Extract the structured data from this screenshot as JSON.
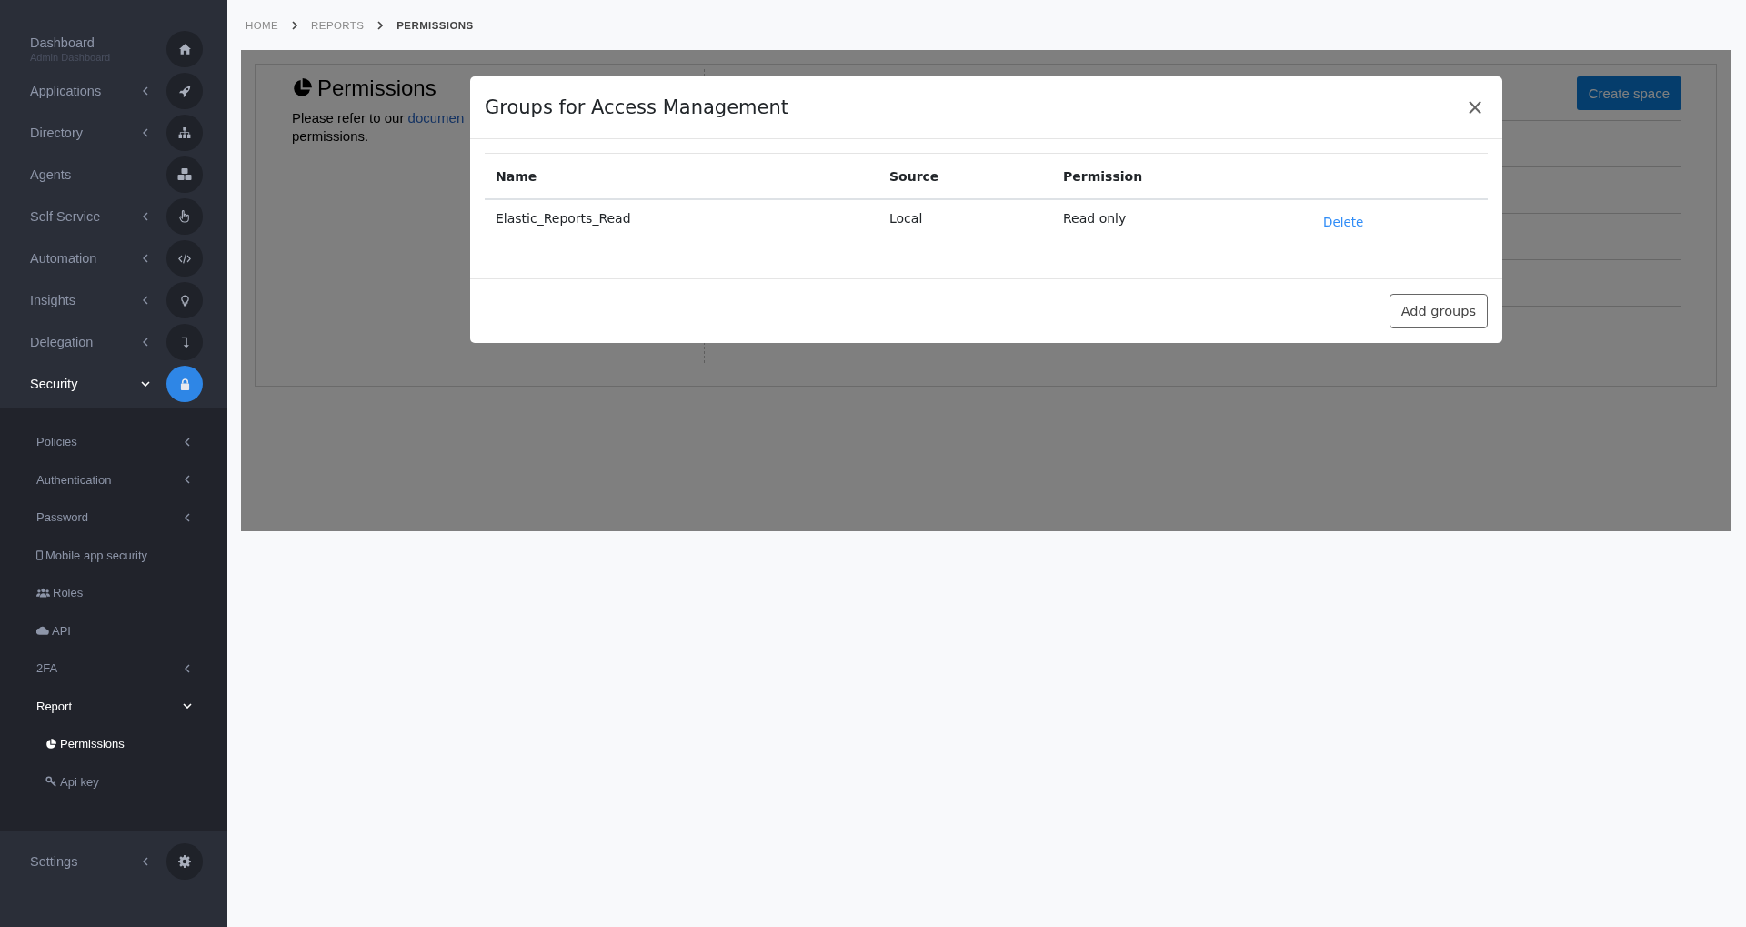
{
  "sidebar": {
    "items": [
      {
        "label": "Dashboard",
        "subtitle": "Admin Dashboard",
        "expandable": false,
        "expanded": false,
        "selected": false
      },
      {
        "label": "Applications",
        "expandable": true,
        "expanded": false,
        "selected": false
      },
      {
        "label": "Directory",
        "expandable": true,
        "expanded": false,
        "selected": false
      },
      {
        "label": "Agents",
        "expandable": false,
        "expanded": false,
        "selected": false
      },
      {
        "label": "Self Service",
        "expandable": true,
        "expanded": false,
        "selected": false
      },
      {
        "label": "Automation",
        "expandable": true,
        "expanded": false,
        "selected": false
      },
      {
        "label": "Insights",
        "expandable": true,
        "expanded": false,
        "selected": false
      },
      {
        "label": "Delegation",
        "expandable": true,
        "expanded": false,
        "selected": false
      },
      {
        "label": "Security",
        "expandable": true,
        "expanded": true,
        "selected": true,
        "children": [
          {
            "label": "Policies",
            "expandable": true,
            "expanded": false
          },
          {
            "label": "Authentication",
            "expandable": true,
            "expanded": false
          },
          {
            "label": "Password",
            "expandable": true,
            "expanded": false
          },
          {
            "label": "Mobile app security",
            "expandable": false,
            "expanded": false
          },
          {
            "label": "Roles",
            "expandable": false,
            "expanded": false
          },
          {
            "label": "API",
            "expandable": false,
            "expanded": false
          },
          {
            "label": "2FA",
            "expandable": true,
            "expanded": false
          },
          {
            "label": "Report",
            "expandable": true,
            "expanded": true,
            "children": [
              {
                "label": "Permissions",
                "selected": true
              },
              {
                "label": "Api key",
                "selected": false
              }
            ]
          }
        ]
      }
    ],
    "footer_items": [
      {
        "label": "Settings",
        "expandable": true,
        "expanded": false,
        "selected": false
      }
    ]
  },
  "breadcrumb": [
    {
      "label": "HOME",
      "selected": false
    },
    {
      "label": "REPORTS",
      "selected": false
    },
    {
      "label": "PERMISSIONS",
      "selected": true
    }
  ],
  "page": {
    "title": "Permissions",
    "text_before_link": "Please refer to our",
    "link": "documen",
    "text_line_2": "permissions.",
    "create_button": "Create space"
  },
  "modal": {
    "title": "Groups for Access Management",
    "close": "×",
    "columns": [
      "Name",
      "Source",
      "Permission"
    ],
    "rows": [
      {
        "name": "Elastic_Reports_Read",
        "source": "Local",
        "permission": "Read only",
        "action": "Delete"
      }
    ],
    "footer_button": "Add groups"
  }
}
